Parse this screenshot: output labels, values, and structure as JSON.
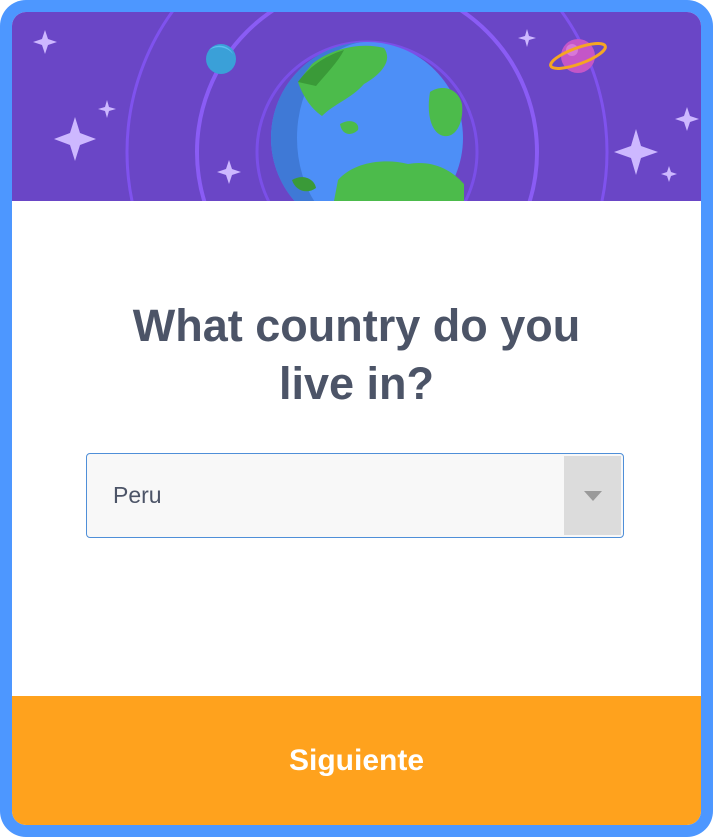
{
  "question": {
    "line1": "What country do you",
    "line2": "live in?"
  },
  "country_select": {
    "selected_value": "Peru",
    "arrow_icon": "chevron-down-icon"
  },
  "next_button": {
    "label": "Siguiente"
  },
  "colors": {
    "frame": "#4d97ff",
    "hero_background": "#6a46c6",
    "orbit": "#8455f2",
    "earth_ocean": "#4d8ff7",
    "earth_land": "#4cbb4b",
    "button": "#ffa21d",
    "question_text": "#4c5467"
  }
}
